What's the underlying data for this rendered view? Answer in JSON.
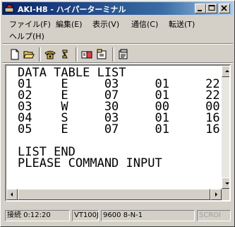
{
  "window": {
    "title": "AKI-H8 - ハイパーターミナル"
  },
  "menu": {
    "items": [
      {
        "label": "ファイル(F)"
      },
      {
        "label": "編集(E)"
      },
      {
        "label": "表示(V)"
      },
      {
        "label": "通信(C)"
      },
      {
        "label": "転送(T)"
      },
      {
        "label": "ヘルプ(H)"
      }
    ]
  },
  "toolbar": {
    "icons": [
      "new-document-icon",
      "open-folder-icon",
      "connect-phone-icon",
      "disconnect-phone-icon",
      "send-icon",
      "receive-icon",
      "properties-icon"
    ]
  },
  "terminal": {
    "lines": [
      "DATA TABLE LIST",
      "01    E     03     01     22",
      "02    E     07     01     22",
      "03    W     30     00     00",
      "04    S     03     01     16",
      "05    E     07     01     16",
      "",
      "LIST END",
      "PLEASE COMMAND INPUT",
      "",
      "_"
    ]
  },
  "status": {
    "connection_time": "接続 0:12:20",
    "emulation": "VT100J",
    "port_settings": "9600 8-N-1",
    "scroll": "SCROl"
  },
  "colors": {
    "title_start": "#0a246a",
    "title_end": "#a6caf0",
    "face": "#d4d0c8"
  }
}
